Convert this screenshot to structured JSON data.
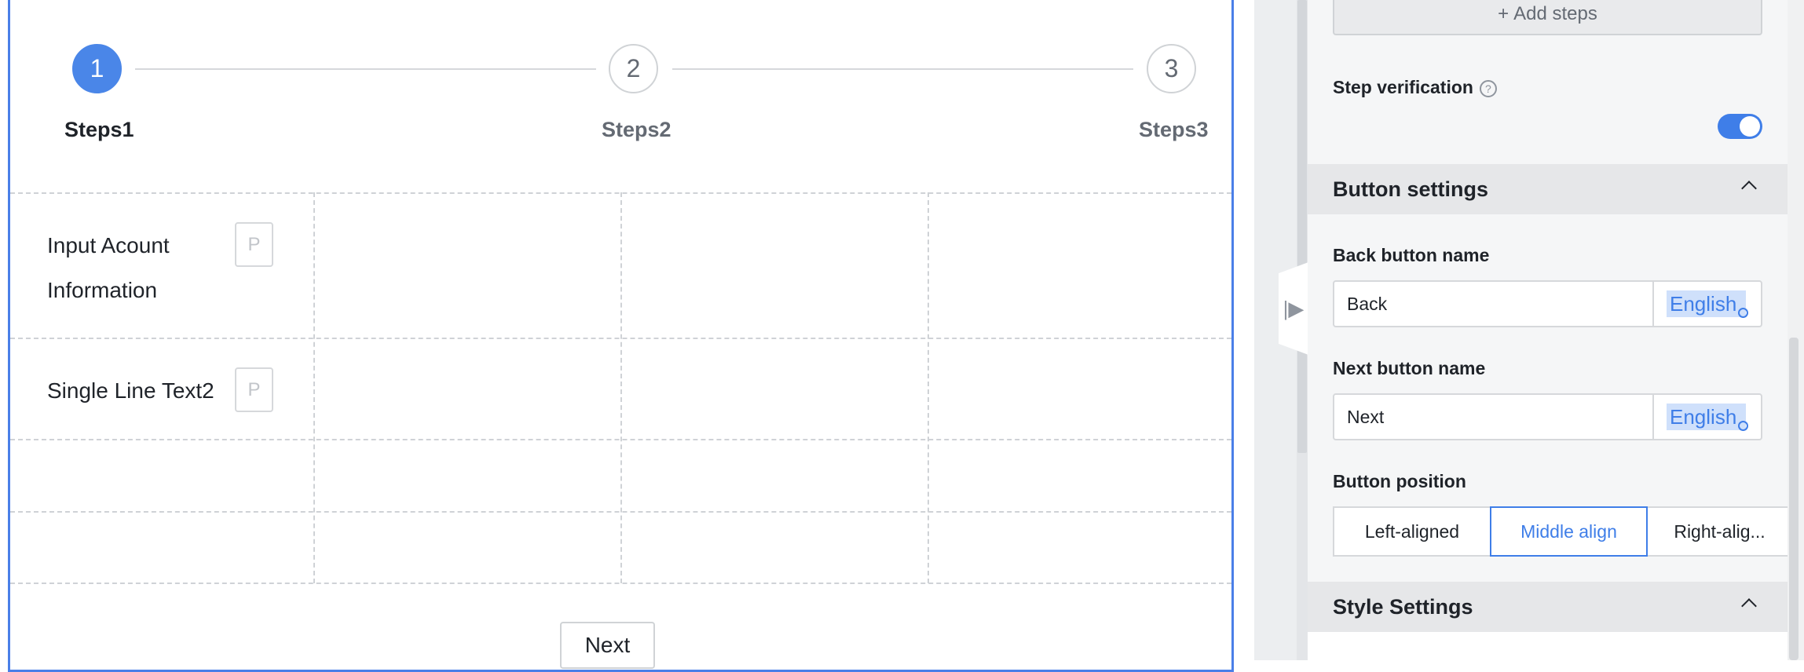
{
  "stepper": {
    "steps": [
      {
        "number": "1",
        "label": "Steps1"
      },
      {
        "number": "2",
        "label": "Steps2"
      },
      {
        "number": "3",
        "label": "Steps3"
      }
    ]
  },
  "form": {
    "fields": [
      {
        "label_line1": "Input Acount",
        "label_line2": "Information",
        "placeholder": "P"
      },
      {
        "label": "Single Line Text2",
        "placeholder": "P"
      }
    ],
    "next_button": "Next"
  },
  "panel": {
    "add_steps_label": "Add steps",
    "step_verification": {
      "label": "Step verification",
      "enabled": true
    },
    "button_settings": {
      "title": "Button settings",
      "back_label": "Back button name",
      "back_value": "Back",
      "next_label": "Next button name",
      "next_value": "Next",
      "language": "English",
      "position_label": "Button position",
      "positions": [
        "Left-aligned",
        "Middle align",
        "Right-alig..."
      ],
      "selected_position": "Middle align"
    },
    "style_settings": {
      "title": "Style Settings"
    }
  },
  "colors": {
    "accent": "#4a86e8",
    "toggle_on": "#3f7ee8"
  }
}
